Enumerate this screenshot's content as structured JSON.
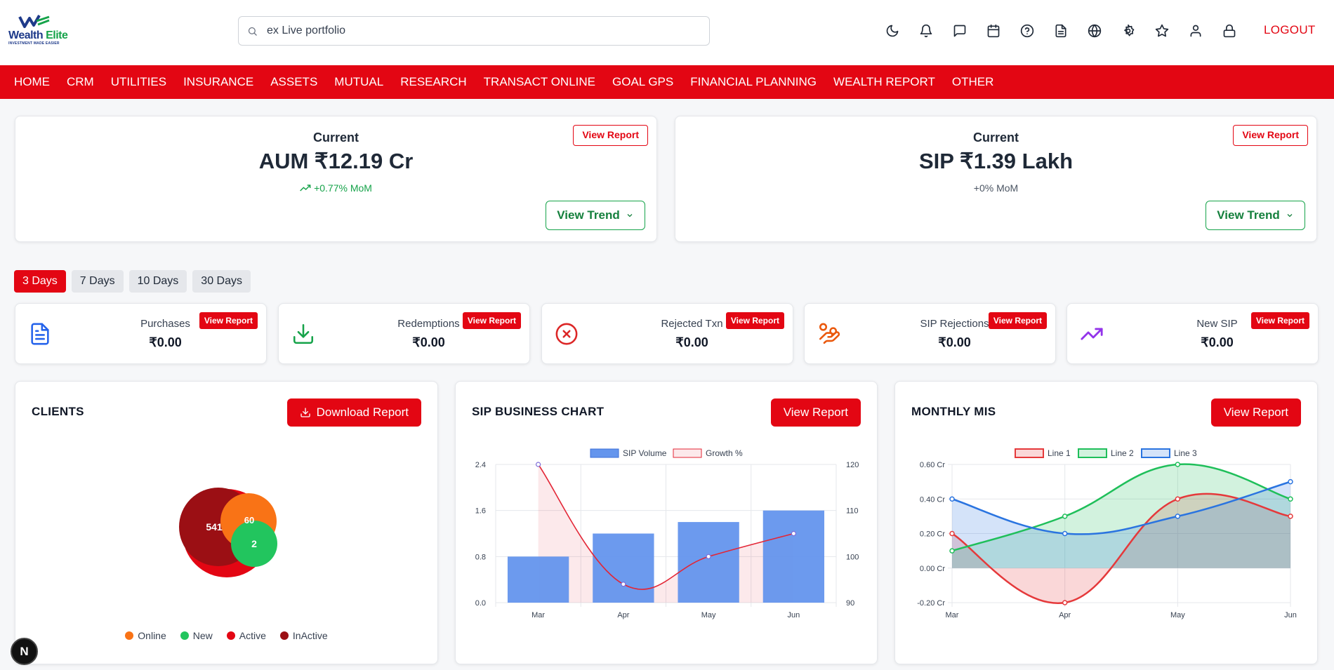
{
  "brand": {
    "name_part1": "Wealth",
    "name_part2": "Elite",
    "tagline": "INVESTMENT MADE EASIER"
  },
  "search": {
    "value": "ex Live portfolio"
  },
  "header_icons": [
    "moon-icon",
    "bell-icon",
    "message-icon",
    "calendar-icon",
    "help-icon",
    "document-icon",
    "globe-icon",
    "settings-icon",
    "star-icon",
    "user-icon",
    "lock-icon"
  ],
  "logout_label": "LOGOUT",
  "nav": [
    "HOME",
    "CRM",
    "UTILITIES",
    "INSURANCE",
    "ASSETS",
    "MUTUAL",
    "RESEARCH",
    "TRANSACT ONLINE",
    "GOAL GPS",
    "FINANCIAL PLANNING",
    "WEALTH REPORT",
    "OTHER"
  ],
  "aum_card": {
    "label": "Current",
    "value": "AUM ₹12.19 Cr",
    "change": "+0.77% MoM",
    "report_label": "View Report",
    "trend_label": "View Trend"
  },
  "sip_card": {
    "label": "Current",
    "value": "SIP ₹1.39 Lakh",
    "change": "+0% MoM",
    "report_label": "View Report",
    "trend_label": "View Trend"
  },
  "day_tabs": [
    "3 Days",
    "7 Days",
    "10 Days",
    "30 Days"
  ],
  "active_day": "3 Days",
  "stats": [
    {
      "label": "Purchases",
      "value": "₹0.00",
      "report": "View Report",
      "icon": "document-icon",
      "color": "#2563eb"
    },
    {
      "label": "Redemptions",
      "value": "₹0.00",
      "report": "View Report",
      "icon": "download-icon",
      "color": "#16a34a"
    },
    {
      "label": "Rejected Txn",
      "value": "₹0.00",
      "report": "View Report",
      "icon": "x-circle-icon",
      "color": "#dc2626"
    },
    {
      "label": "SIP Rejections",
      "value": "₹0.00",
      "report": "View Report",
      "icon": "hand-coins-icon",
      "color": "#ea580c"
    },
    {
      "label": "New SIP",
      "value": "₹0.00",
      "report": "View Report",
      "icon": "trending-up-icon",
      "color": "#9333ea"
    }
  ],
  "clients_panel": {
    "title": "CLIENTS",
    "button": "Download Report",
    "bubbles": [
      {
        "label": "Active",
        "value": "",
        "color": "#e30613"
      },
      {
        "label": "InActive",
        "value": "541",
        "color": "#9b0f14"
      },
      {
        "label": "Online",
        "value": "60",
        "color": "#f97316"
      },
      {
        "label": "New",
        "value": "2",
        "color": "#22c55e"
      }
    ],
    "legend": [
      {
        "label": "Online",
        "color": "#f97316"
      },
      {
        "label": "New",
        "color": "#22c55e"
      },
      {
        "label": "Active",
        "color": "#e30613"
      },
      {
        "label": "InActive",
        "color": "#9b0f14"
      }
    ]
  },
  "sip_panel": {
    "title": "SIP BUSINESS CHART",
    "button": "View Report"
  },
  "mis_panel": {
    "title": "MONTHLY MIS",
    "button": "View Report"
  },
  "chart_data": [
    {
      "type": "bar",
      "categories": [
        "Mar",
        "Apr",
        "May",
        "Jun"
      ],
      "series": [
        {
          "name": "SIP Volume",
          "values": [
            0.8,
            1.2,
            1.4,
            1.6
          ],
          "color": "#6495ed",
          "axis": "left"
        },
        {
          "name": "Growth %",
          "values": [
            120,
            94,
            100,
            105
          ],
          "color": "#e32636",
          "type": "line",
          "axis": "right"
        }
      ],
      "ylim": [
        0,
        2.4
      ],
      "yticks": [
        "0.0",
        "0.8",
        "1.6",
        "2.4"
      ],
      "y2lim": [
        90,
        120
      ],
      "y2ticks": [
        "90",
        "100",
        "110",
        "120"
      ],
      "legend": "top"
    },
    {
      "type": "area",
      "categories": [
        "Mar",
        "Apr",
        "May",
        "Jun"
      ],
      "series": [
        {
          "name": "Line 1",
          "values": [
            0.2,
            -0.2,
            0.4,
            0.3
          ],
          "color": "#e5393b",
          "fill": "rgba(229,57,59,0.2)"
        },
        {
          "name": "Line 2",
          "values": [
            0.1,
            0.3,
            0.6,
            0.4
          ],
          "color": "#1fbf5a",
          "fill": "rgba(31,191,90,0.2)"
        },
        {
          "name": "Line 3",
          "values": [
            0.4,
            0.2,
            0.3,
            0.5
          ],
          "color": "#2a74e0",
          "fill": "rgba(42,116,224,0.2)"
        }
      ],
      "ylim": [
        -0.2,
        0.6
      ],
      "yticks": [
        "-0.20 Cr",
        "0.00 Cr",
        "0.20 Cr",
        "0.40 Cr",
        "0.60 Cr"
      ],
      "legend": "top"
    }
  ]
}
